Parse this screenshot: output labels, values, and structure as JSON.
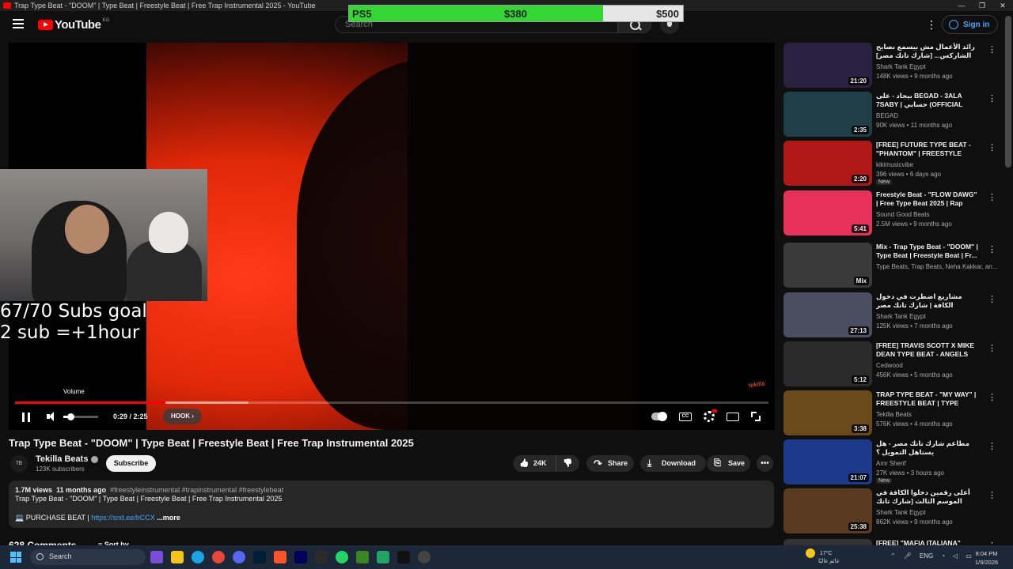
{
  "browser": {
    "tab_title": "Trap Type Beat - \"DOOM\" | Type Beat | Freestyle Beat | Free Trap Instrumental 2025 - YouTube"
  },
  "goal_bar": {
    "label": "PS5",
    "current": "$380",
    "target": "$500",
    "progress": 0.76
  },
  "header": {
    "logo": "YouTube",
    "country": "EG",
    "search_placeholder": "Search",
    "signin": "Sign in"
  },
  "player": {
    "volume_tooltip": "Volume",
    "time": "0:29 / 2:25",
    "chapter": "HOOK",
    "watermark": "tekilla",
    "progress_played": 0.2,
    "progress_buffered": 0.31,
    "volume_level": 0.2
  },
  "overlay": {
    "goal_line1": "67/70 Subs goal",
    "goal_line2": "2 sub =+1hour"
  },
  "video": {
    "title": "Trap Type Beat - \"DOOM\" | Type Beat | Freestyle Beat | Free Trap Instrumental 2025",
    "channel": "Tekilla Beats",
    "subscribers": "123K subscribers",
    "subscribe": "Subscribe",
    "likes": "24K",
    "share": "Share",
    "download": "Download",
    "save": "Save",
    "more": "•••"
  },
  "description": {
    "views": "1.7M views",
    "age": "11 months ago",
    "tags": "#freestyleinstrumental #trapinstrumental #freestylebeat",
    "line2": "Trap Type Beat - \"DOOM\" | Type Beat | Freestyle Beat | Free Trap Instrumental 2025",
    "line3_prefix": "💻 PURCHASE BEAT | ",
    "link": "https://snd.ee/bCCX",
    "more": "...more"
  },
  "comments": {
    "count": "628 Comments",
    "sort": "Sort by"
  },
  "sidebar": [
    {
      "title": "رائد الأعمال مش بيسمع نصايح الشاركس... [شارك تانك مصر]",
      "channel": "Shark Tank Egypt",
      "views": "148K views • 9 months ago",
      "duration": "21:20",
      "color": "#2a2040"
    },
    {
      "title": "بيجاد - على BEGAD - 3ALA 7SABY | حسابي (OFFICIAL MUSIC VIDEO)",
      "channel": "BEGAD",
      "views": "90K views • 11 months ago",
      "duration": "2:35",
      "color": "#1f3e48"
    },
    {
      "title": "[FREE] FUTURE TYPE BEAT - \"PHANTOM\" | FREESTYLE BEA...",
      "channel": "kikimusicvibe",
      "views": "396 views • 6 days ago",
      "duration": "2:20",
      "new": "New",
      "color": "#b01818"
    },
    {
      "title": "Freestyle Beat - \"FLOW DAWG\" | Free Type Beat 2025 | Rap Tra...",
      "channel": "Sound Good Beats",
      "views": "2.5M views • 9 months ago",
      "duration": "5:41",
      "color": "#e8315a"
    },
    {
      "title": "Mix - Trap Type Beat - \"DOOM\" | Type Beat | Freestyle Beat | Fr...",
      "channel": "Type Beats, Trap Beats, Neha Kakkar, an...",
      "views": "",
      "duration": "Mix",
      "color": "#3a3a3a"
    },
    {
      "title": "مشاريع اضطرت في دخول الكافة | شارك تانك مصر",
      "channel": "Shark Tank Egypt",
      "views": "125K views • 7 months ago",
      "duration": "27:13",
      "color": "#4a4e60"
    },
    {
      "title": "[FREE] TRAVIS SCOTT X MIKE DEAN TYPE BEAT - ANGELS",
      "channel": "Cedwood",
      "views": "456K views • 5 months ago",
      "duration": "5:12",
      "color": "#2b2b2b"
    },
    {
      "title": "TRAP TYPE BEAT - \"MY WAY\" | FREESTYLE BEAT | TYPE BEAT...",
      "channel": "Tekilla Beats",
      "views": "576K views • 4 months ago",
      "duration": "3:38",
      "color": "#6a4a1a"
    },
    {
      "title": "مطاعم شارك تانك مصر - هل يستاهل التمويل ؟",
      "channel": "Amr Sherif",
      "views": "27K views • 3 hours ago",
      "duration": "21:07",
      "new": "New",
      "color": "#1d3a8a"
    },
    {
      "title": "أعلى رقمين دخلوا الكافة في الموسم الثالث [شارك تانك مصر]",
      "channel": "Shark Tank Egypt",
      "views": "862K views • 9 months ago",
      "duration": "25:38",
      "color": "#5a3a20"
    },
    {
      "title": "[FREE] \"MAFIA ITALIANA\"",
      "channel": "",
      "views": "",
      "duration": "",
      "color": "#333"
    }
  ],
  "taskbar": {
    "search": "Search",
    "temp": "17°C",
    "weather_text": "غائم غالبًا",
    "lang": "ENG",
    "time": "8:04 PM",
    "date": "1/9/2026"
  }
}
